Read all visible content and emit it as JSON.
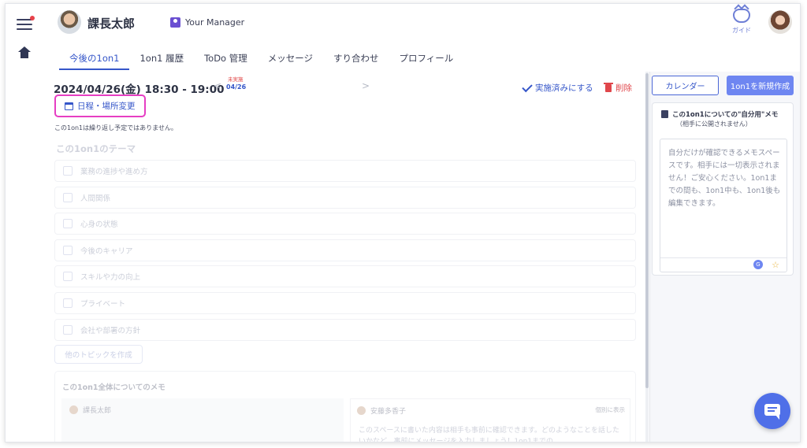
{
  "header": {
    "user_name": "課長太郎",
    "manager_label": "Your Manager",
    "guide_label": "ガイド"
  },
  "tabs": [
    {
      "label": "今後の1on1",
      "active": true
    },
    {
      "label": "1on1 履歴",
      "active": false
    },
    {
      "label": "ToDo 管理",
      "active": false
    },
    {
      "label": "メッセージ",
      "active": false
    },
    {
      "label": "すり合わせ",
      "active": false
    },
    {
      "label": "プロフィール",
      "active": false
    }
  ],
  "meeting": {
    "datetime": "2024/04/26(金) 18:30 - 19:00",
    "status": "未実施",
    "short_date": "04/26",
    "mark_done": "実施済みにする",
    "delete": "削除",
    "reschedule": "日程・場所変更",
    "repeat_note": "この1on1は繰り返し予定ではありません。"
  },
  "themes": {
    "heading": "この1on1のテーマ",
    "items": [
      "業務の進捗や進め方",
      "人間関係",
      "心身の状態",
      "今後のキャリア",
      "スキルや力の向上",
      "プライベート",
      "会社や部署の方針"
    ],
    "add_button": "他のトピックを作成"
  },
  "memo": {
    "heading": "この1on1全体についてのメモ",
    "left_author": "課長太郎",
    "right_author": "安藤多香子",
    "right_toggle": "個別に表示",
    "right_body": "このスペースに書いた内容は相手も事前に確認できます。どのようなことを話したいかなど、事前にメッセージを入力しましょう！1on1までの"
  },
  "sidebar": {
    "calendar_button": "カレンダー",
    "new_button": "1on1を新規作成",
    "private_memo_title": "この1on1についての\"自分用\"メモ",
    "private_memo_sub": "（相手に公開されません）",
    "private_memo_placeholder": "自分だけが確認できるメモスペースです。相手には一切表示されません！ご安心ください。1on1までの間も、1on1中も、1on1後も編集できます。",
    "grammar_icon_text": "G"
  },
  "colors": {
    "accent": "#3556c9",
    "highlight": "#e63ec3",
    "danger": "#e0464b",
    "primary_button": "#6e86f1"
  },
  "icons": [
    "hamburger-icon",
    "home-icon",
    "check-icon",
    "trash-icon",
    "calendar-icon",
    "chat-icon",
    "guide-icon"
  ]
}
